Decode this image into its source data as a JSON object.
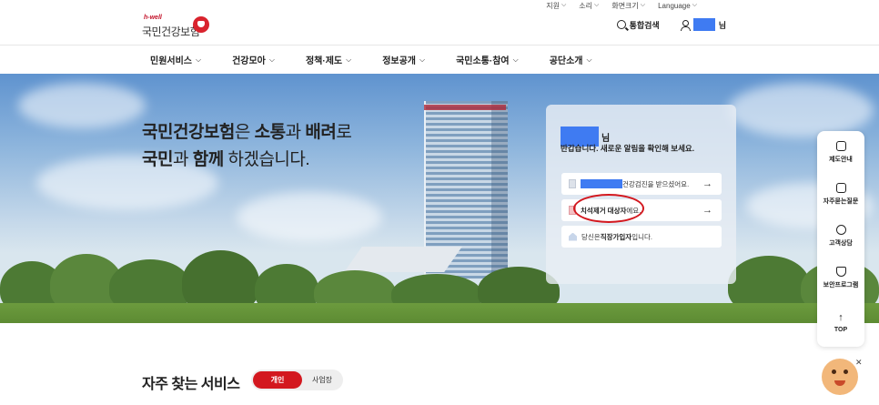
{
  "utility_bar": [
    {
      "label": "지원"
    },
    {
      "label": "소리"
    },
    {
      "label": "화면크기"
    },
    {
      "label": "Language"
    }
  ],
  "logo": {
    "tagline": "h-well",
    "name": "국민건강보험"
  },
  "header": {
    "search_label": "통합검색",
    "user_suffix": "님"
  },
  "nav": [
    {
      "label": "민원서비스"
    },
    {
      "label": "건강모아"
    },
    {
      "label": "정책·제도"
    },
    {
      "label": "정보공개"
    },
    {
      "label": "국민소통·참여"
    },
    {
      "label": "공단소개"
    }
  ],
  "hero": {
    "line1_a": "국민건강보험",
    "line1_b": "은 ",
    "line1_c": "소통",
    "line1_d": "과 ",
    "line1_e": "배려",
    "line1_f": "로",
    "line2_a": "국민",
    "line2_b": "과 ",
    "line2_c": "함께",
    "line2_d": " 하겠습니다."
  },
  "card": {
    "name_suffix": "님",
    "greeting": "반갑습니다. 새로운 알림을 확인해 보세요.",
    "row1_text": "건강검진을 받으셨어요.",
    "row2_bold": "치석제거 대상자",
    "row2_text": "에요.",
    "row3_prefix": "당신은 ",
    "row3_bold": "직장가입자",
    "row3_suffix": "입니다.",
    "arrow": "→"
  },
  "float_menu": [
    {
      "label": "제도안내",
      "icon": "book-icon"
    },
    {
      "label": "자주묻는질문",
      "icon": "faq-icon"
    },
    {
      "label": "고객상담",
      "icon": "chat-icon"
    },
    {
      "label": "보안프로그램",
      "icon": "shield-icon"
    },
    {
      "label": "TOP",
      "icon": "arrow-up-icon"
    }
  ],
  "services": {
    "title": "자주 찾는 서비스",
    "tab_personal": "개인",
    "tab_business": "사업장"
  },
  "colors": {
    "brand_red": "#d3181f",
    "redaction_blue": "#3f7bf2"
  }
}
